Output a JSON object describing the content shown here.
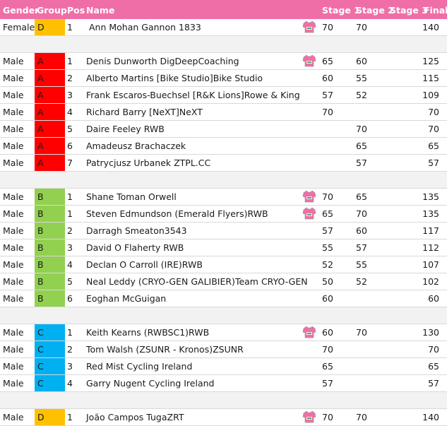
{
  "colors": {
    "header_bg": "#f06ea8",
    "group_D": "#ffc000",
    "group_A": "#ff0000",
    "group_B": "#92d050",
    "group_C": "#00b0f0",
    "jersey": "#f06ea8"
  },
  "header": {
    "gender": "Gender",
    "group": "Group",
    "pos": "Pos",
    "name": "Name",
    "stage1": "Stage 1",
    "stage2": "Stage 2",
    "stage3": "Stage 3",
    "final": "Final"
  },
  "rows": [
    {
      "type": "data",
      "gender": "Female",
      "group": "D",
      "pos": "1",
      "name": "Ann Mohan Gannon 1833",
      "s1": "70",
      "s2": "70",
      "final": "140",
      "jersey": true,
      "indent": true
    },
    {
      "type": "blank"
    },
    {
      "type": "data",
      "gender": "Male",
      "group": "A",
      "pos": "1",
      "name": "Denis Dunworth DigDeepCoaching",
      "s1": "65",
      "s2": "60",
      "final": "125",
      "jersey": true
    },
    {
      "type": "data",
      "gender": "Male",
      "group": "A",
      "pos": "2",
      "name": "Alberto Martins [Bike Studio]Bike Studio",
      "s1": "60",
      "s2": "55",
      "final": "115",
      "jersey": false
    },
    {
      "type": "data",
      "gender": "Male",
      "group": "A",
      "pos": "3",
      "name": "Frank Escaros-Buechsel [R&K Lions]Rowe & King",
      "s1": "57",
      "s2": "52",
      "final": "109",
      "jersey": false
    },
    {
      "type": "data",
      "gender": "Male",
      "group": "A",
      "pos": "4",
      "name": "Richard Barry [NeXT]NeXT",
      "s1": "70",
      "s2": "",
      "final": "70",
      "jersey": false
    },
    {
      "type": "data",
      "gender": "Male",
      "group": "A",
      "pos": "5",
      "name": "Daire Feeley RWB",
      "s1": "",
      "s2": "70",
      "final": "70",
      "jersey": false
    },
    {
      "type": "data",
      "gender": "Male",
      "group": "A",
      "pos": "6",
      "name": "Amadeusz Brachaczek",
      "s1": "",
      "s2": "65",
      "final": "65",
      "jersey": false
    },
    {
      "type": "data",
      "gender": "Male",
      "group": "A",
      "pos": "7",
      "name": "Patrycjusz Urbanek ZTPL.CC",
      "s1": "",
      "s2": "57",
      "final": "57",
      "jersey": false
    },
    {
      "type": "blank"
    },
    {
      "type": "data",
      "gender": "Male",
      "group": "B",
      "pos": "1",
      "name": "Shane Toman Orwell",
      "s1": "70",
      "s2": "65",
      "final": "135",
      "jersey": true
    },
    {
      "type": "data",
      "gender": "Male",
      "group": "B",
      "pos": "1",
      "name": "Steven Edmundson (Emerald Flyers)RWB",
      "s1": "65",
      "s2": "70",
      "final": "135",
      "jersey": true
    },
    {
      "type": "data",
      "gender": "Male",
      "group": "B",
      "pos": "2",
      "name": "Darragh Smeaton3543",
      "s1": "57",
      "s2": "60",
      "final": "117",
      "jersey": false
    },
    {
      "type": "data",
      "gender": "Male",
      "group": "B",
      "pos": "3",
      "name": "David O Flaherty RWB",
      "s1": "55",
      "s2": "57",
      "final": "112",
      "jersey": false
    },
    {
      "type": "data",
      "gender": "Male",
      "group": "B",
      "pos": "4",
      "name": "Declan O Carroll (IRE)RWB",
      "s1": "52",
      "s2": "55",
      "final": "107",
      "jersey": false
    },
    {
      "type": "data",
      "gender": "Male",
      "group": "B",
      "pos": "5",
      "name": "Neal Leddy (CRYO-GEN GALIBIER)Team CRYO-GEN",
      "s1": "50",
      "s2": "52",
      "final": "102",
      "jersey": false
    },
    {
      "type": "data",
      "gender": "Male",
      "group": "B",
      "pos": "6",
      "name": "Eoghan McGuigan",
      "s1": "60",
      "s2": "",
      "final": "60",
      "jersey": false
    },
    {
      "type": "blank"
    },
    {
      "type": "data",
      "gender": "Male",
      "group": "C",
      "pos": "1",
      "name": "Keith Kearns (RWBSC1)RWB",
      "s1": "60",
      "s2": "70",
      "final": "130",
      "jersey": true
    },
    {
      "type": "data",
      "gender": "Male",
      "group": "C",
      "pos": "2",
      "name": "Tom Walsh (ZSUNR - Kronos)ZSUNR",
      "s1": "70",
      "s2": "",
      "final": "70",
      "jersey": false
    },
    {
      "type": "data",
      "gender": "Male",
      "group": "C",
      "pos": "3",
      "name": "Red Mist Cycling Ireland",
      "s1": "65",
      "s2": "",
      "final": "65",
      "jersey": false
    },
    {
      "type": "data",
      "gender": "Male",
      "group": "C",
      "pos": "4",
      "name": "Garry Nugent Cycling Ireland",
      "s1": "57",
      "s2": "",
      "final": "57",
      "jersey": false
    },
    {
      "type": "blank"
    },
    {
      "type": "data",
      "gender": "Male",
      "group": "D",
      "pos": "1",
      "name": "João Campos TugaZRT",
      "s1": "70",
      "s2": "70",
      "final": "140",
      "jersey": true
    }
  ]
}
